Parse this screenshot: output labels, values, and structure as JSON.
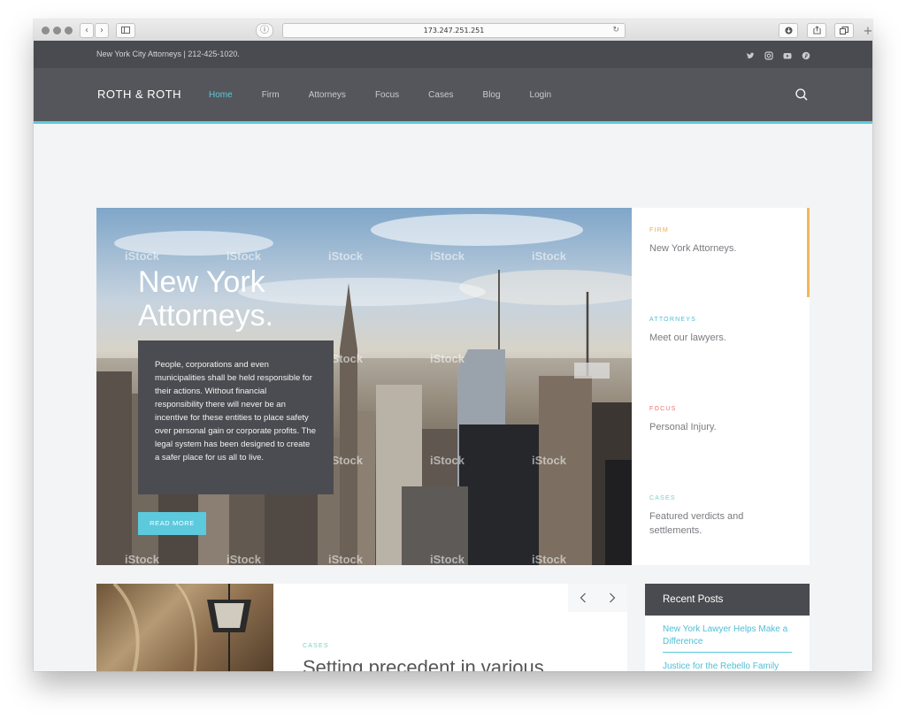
{
  "browser": {
    "url": "173.247.251.251"
  },
  "topbar": {
    "contact": "New York City Attorneys | 212-425-1020.",
    "social": [
      "twitter-icon",
      "instagram-icon",
      "youtube-icon",
      "pinterest-icon"
    ]
  },
  "nav": {
    "brand": "ROTH & ROTH",
    "items": [
      "Home",
      "Firm",
      "Attorneys",
      "Focus",
      "Cases",
      "Blog",
      "Login"
    ],
    "active": "Home"
  },
  "hero": {
    "title_line1": "New York",
    "title_line2": "Attorneys.",
    "body": "People, corporations and even municipalities shall be held responsible for their actions. Without financial responsibility there will never be an incentive for these entities to place safety over personal gain or corporate profits. The legal system has been designed to create a safer place for us all to live.",
    "cta": "READ MORE",
    "watermark": "iStock"
  },
  "tabs": [
    {
      "category": "FIRM",
      "text": "New York Attorneys.",
      "color": "#f2a84e"
    },
    {
      "category": "ATTORNEYS",
      "text": "Meet our lawyers.",
      "color": "#4fbfd4"
    },
    {
      "category": "FOCUS",
      "text": "Personal Injury.",
      "color": "#e8776e"
    },
    {
      "category": "CASES",
      "text": "Featured verdicts and settlements.",
      "color": "#7fd0c0"
    }
  ],
  "cases": {
    "category": "CASES",
    "title": "Setting precedent in various"
  },
  "recent_posts": {
    "title": "Recent Posts",
    "items": [
      "New York Lawyer Helps Make a Difference",
      "Justice for the Rebello Family"
    ]
  },
  "colors": {
    "accent": "#5cc9dd",
    "nav_bg": "#55565b",
    "topbar_bg": "#4a4b50",
    "firm_highlight": "#f2b75a"
  }
}
